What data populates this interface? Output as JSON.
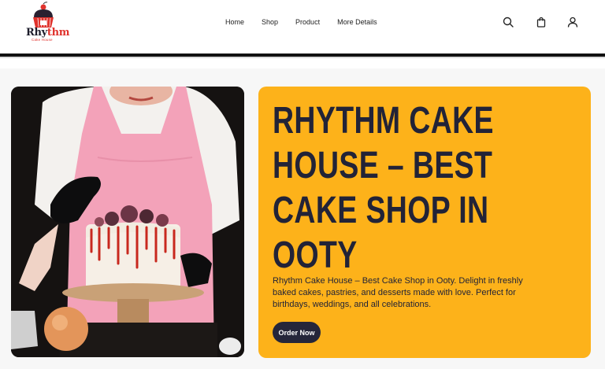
{
  "brand": {
    "word_a": "Rhy",
    "word_b": "thm",
    "tagline": "Cake House",
    "logo_icon": "cupcake-logo-icon"
  },
  "nav": {
    "items": [
      {
        "label": "Home"
      },
      {
        "label": "Shop"
      },
      {
        "label": "Product"
      },
      {
        "label": "More Details"
      }
    ]
  },
  "header_icons": [
    "search-icon",
    "shopping-bag-icon",
    "user-icon"
  ],
  "hero": {
    "title": "Rhythm Cake House – Best Cake Shop in Ooty",
    "description": "Rhythm Cake House – Best Cake Shop in Ooty. Delight in freshly baked cakes, pastries, and desserts made with love. Perfect for birthdays, weddings, and all celebrations.",
    "cta_label": "Order Now"
  },
  "colors": {
    "accent": "#fdb21a",
    "dark": "#25263a",
    "brand_red": "#e0332d"
  }
}
